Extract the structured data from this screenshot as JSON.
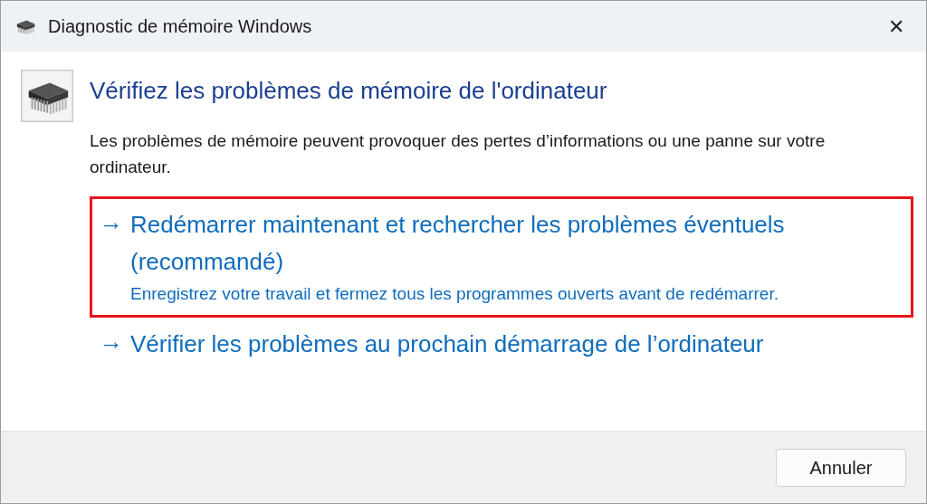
{
  "window": {
    "title": "Diagnostic de mémoire Windows",
    "close": "✕"
  },
  "heading": "Vérifiez les problèmes de mémoire de l'ordinateur",
  "description": "Les problèmes de mémoire peuvent provoquer des pertes d’informations ou une panne sur votre ordinateur.",
  "options": [
    {
      "arrow": "→",
      "title": "Redémarrer maintenant et rechercher les problèmes éventuels (recommandé)",
      "detail": "Enregistrez votre travail et fermez tous les programmes ouverts avant de redémarrer.",
      "highlighted": true
    },
    {
      "arrow": "→",
      "title": "Vérifier les problèmes au prochain démarrage de l’ordinateur",
      "highlighted": false
    }
  ],
  "buttons": [
    "Annuler"
  ]
}
